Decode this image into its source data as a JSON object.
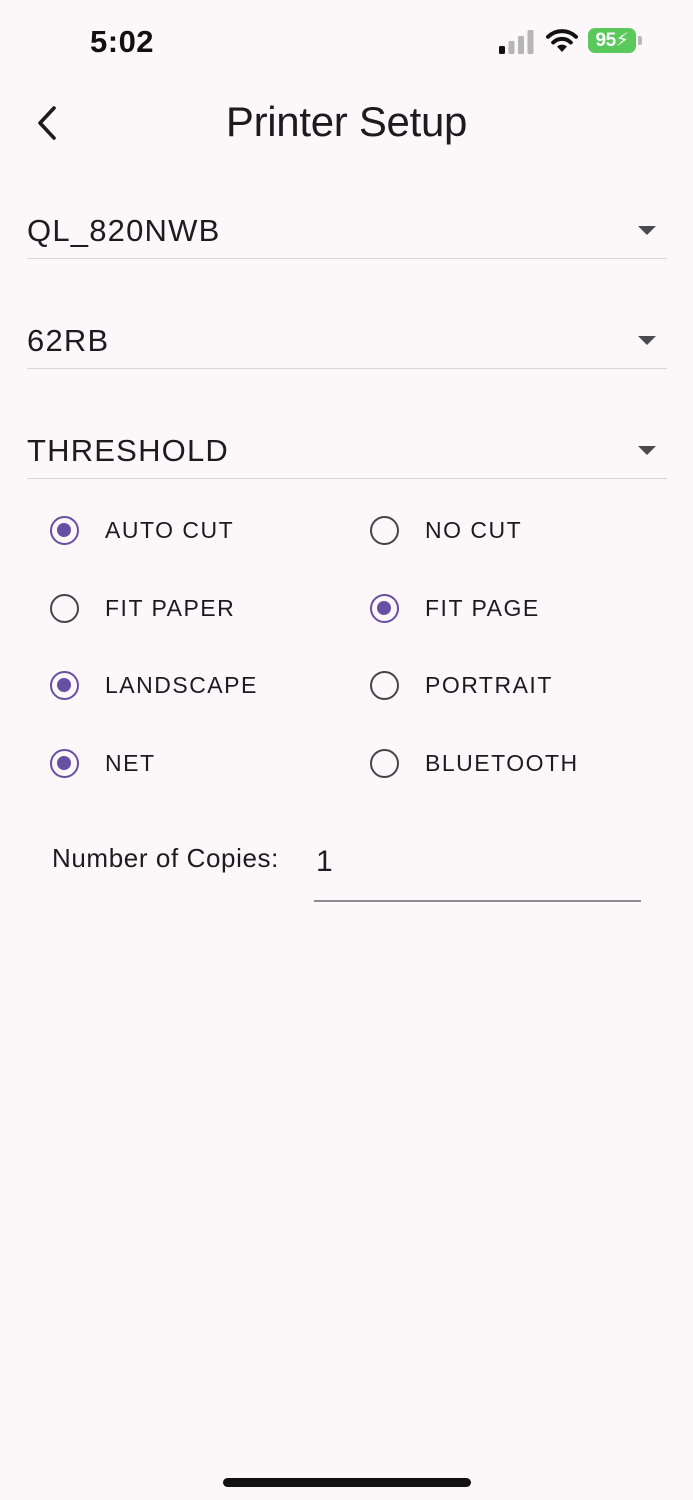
{
  "status_bar": {
    "time": "5:02",
    "battery_level": "95"
  },
  "header": {
    "title": "Printer Setup"
  },
  "dropdowns": {
    "printer_model": "QL_820NWB",
    "label_size": "62RB",
    "print_mode": "THRESHOLD"
  },
  "options": {
    "auto_cut": {
      "label": "AUTO CUT",
      "selected": true
    },
    "no_cut": {
      "label": "NO CUT",
      "selected": false
    },
    "fit_paper": {
      "label": "FIT PAPER",
      "selected": false
    },
    "fit_page": {
      "label": "FIT PAGE",
      "selected": true
    },
    "landscape": {
      "label": "LANDSCAPE",
      "selected": true
    },
    "portrait": {
      "label": "PORTRAIT",
      "selected": false
    },
    "net": {
      "label": "NET",
      "selected": true
    },
    "bluetooth": {
      "label": "BLUETOOTH",
      "selected": false
    }
  },
  "copies": {
    "label": "Number of Copies:",
    "value": "1"
  },
  "colors": {
    "accent": "#6750a4",
    "background": "#fcf8f9",
    "battery": "#5ac85a"
  }
}
